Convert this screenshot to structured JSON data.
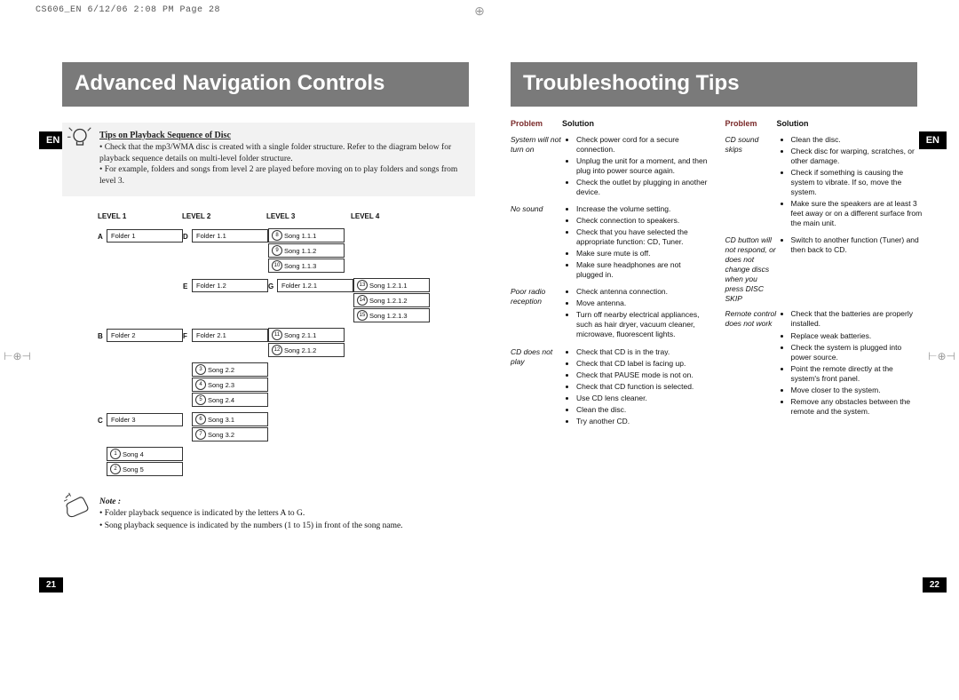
{
  "print_header": "CS606_EN  6/12/06  2:08 PM  Page 28",
  "lang": "EN",
  "left": {
    "title": "Advanced Navigation Controls",
    "tips": {
      "heading": "Tips on Playback Sequence of Disc",
      "lines": [
        "• Check that the mp3/WMA disc is created with a single folder structure. Refer to the diagram below for playback sequence details on multi-level folder structure.",
        "• For example, folders and songs from level 2 are played before moving on to play folders and songs from level 3."
      ]
    },
    "levels": [
      "LEVEL 1",
      "LEVEL 2",
      "LEVEL 3",
      "LEVEL 4"
    ],
    "diagram": {
      "A": {
        "l1": "Folder 1",
        "D": "Folder 1.1",
        "songsD": [
          "Song 1.1.1",
          "Song 1.1.2",
          "Song 1.1.3"
        ],
        "numsD": [
          "8",
          "9",
          "10"
        ],
        "E": "Folder 1.2",
        "G": "Folder 1.2.1",
        "songsG": [
          "Song 1.2.1.1",
          "Song 1.2.1.2",
          "Song 1.2.1.3"
        ],
        "numsG": [
          "13",
          "14",
          "15"
        ]
      },
      "B": {
        "l1": "Folder 2",
        "F": "Folder 2.1",
        "songsF": [
          "Song 2.1.1",
          "Song 2.1.2"
        ],
        "numsF": [
          "11",
          "12"
        ],
        "songsB": [
          "Song 2.2",
          "Song 2.3",
          "Song 2.4"
        ],
        "numsB": [
          "3",
          "4",
          "5"
        ]
      },
      "C": {
        "l1": "Folder 3",
        "songsC": [
          "Song 3.1",
          "Song 3.2"
        ],
        "numsC": [
          "6",
          "7"
        ]
      },
      "root": {
        "songs": [
          "Song 4",
          "Song 5"
        ],
        "nums": [
          "1",
          "2"
        ]
      }
    },
    "note": {
      "heading": "Note :",
      "lines": [
        "• Folder playback sequence is indicated by the letters A to G.",
        "• Song playback sequence is indicated by the numbers (1 to 15) in front of the song name."
      ]
    },
    "page": "21"
  },
  "right": {
    "title": "Troubleshooting Tips",
    "headers": {
      "problem": "Problem",
      "solution": "Solution"
    },
    "col1": [
      {
        "p": "System will not turn on",
        "s": [
          "Check power cord for a secure connection.",
          "Unplug the unit for a moment, and then plug into power source again.",
          "Check the outlet by plugging in another device."
        ]
      },
      {
        "p": "No sound",
        "s": [
          "Increase the volume setting.",
          "Check connection to speakers.",
          "Check that you have selected the appropriate function: CD, Tuner.",
          "Make sure mute is off.",
          "Make sure headphones are not plugged in."
        ]
      },
      {
        "p": "Poor radio reception",
        "s": [
          "Check antenna connection.",
          "Move antenna.",
          "Turn off nearby electrical appliances, such as hair dryer, vacuum cleaner, microwave, fluorescent lights."
        ]
      },
      {
        "p": "CD does not play",
        "s": [
          "Check that CD is in the tray.",
          "Check that CD label is facing up.",
          "Check that PAUSE mode is not on.",
          "Check that CD function is selected.",
          "Use CD lens cleaner.",
          "Clean the disc.",
          "Try another CD."
        ]
      }
    ],
    "col2": [
      {
        "p": "CD sound skips",
        "s": [
          "Clean the disc.",
          "Check disc for warping, scratches, or other damage.",
          "Check if something is causing the system to vibrate. If so, move the system.",
          "Make sure the speakers are at least 3 feet away or on a different surface from the main unit."
        ]
      },
      {
        "p": "CD button will not respond, or does not change discs when you press DISC SKIP",
        "s": [
          "Switch to another function (Tuner) and then back to CD."
        ]
      },
      {
        "p": "Remote control does not work",
        "s": [
          "Check that the batteries are properly installed.",
          "Replace weak batteries.",
          "Check the system is plugged into power source.",
          "Point the remote directly at the system's front panel.",
          "Move closer to the system.",
          "Remove any obstacles between the remote and the system."
        ]
      }
    ],
    "page": "22"
  }
}
